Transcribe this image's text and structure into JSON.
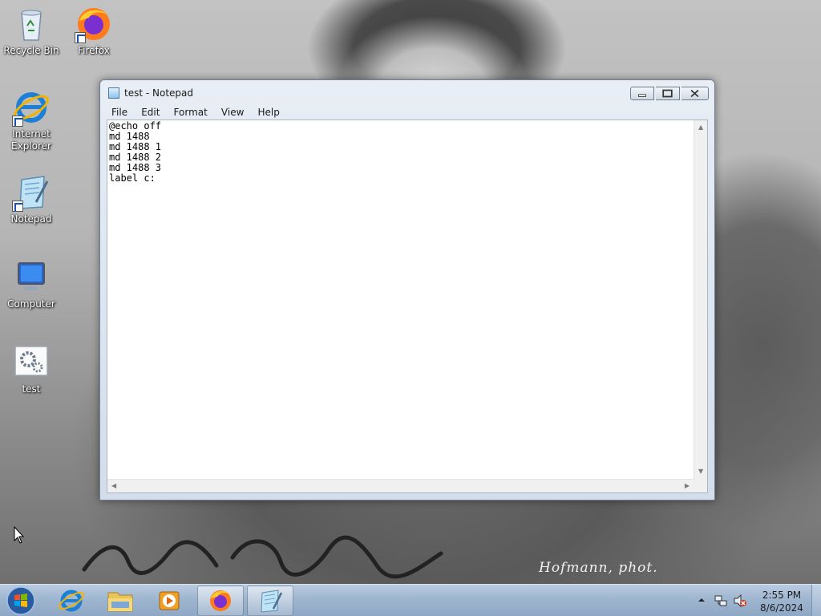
{
  "desktop": {
    "icons": [
      {
        "label": "Recycle Bin",
        "icon": "recycle-bin-icon"
      },
      {
        "label": "Firefox",
        "icon": "firefox-icon"
      },
      {
        "label": "Internet Explorer",
        "icon": "internet-explorer-icon"
      },
      {
        "label": "Notepad",
        "icon": "notepad-icon"
      },
      {
        "label": "Computer",
        "icon": "computer-icon"
      },
      {
        "label": "test",
        "icon": "batch-file-icon"
      }
    ],
    "photo_credit": "Hofmann, phot."
  },
  "window": {
    "title": "test - Notepad",
    "menu": [
      "File",
      "Edit",
      "Format",
      "View",
      "Help"
    ],
    "content": "@echo off\nmd 1488\nmd 1488 1\nmd 1488 2\nmd 1488 3\nlabel c:"
  },
  "taskbar": {
    "apps": [
      {
        "name": "Internet Explorer",
        "icon": "internet-explorer-icon"
      },
      {
        "name": "Windows Explorer",
        "icon": "folder-icon"
      },
      {
        "name": "Windows Media Player",
        "icon": "media-player-icon"
      },
      {
        "name": "Firefox",
        "icon": "firefox-icon"
      },
      {
        "name": "Notepad",
        "icon": "notepad-icon"
      }
    ],
    "clock": {
      "time": "2:55 PM",
      "date": "8/6/2024"
    }
  },
  "colors": {
    "taskbar": "#9fb6d0",
    "window_frame": "#dfe7f1",
    "editor_bg": "#ffffff"
  }
}
